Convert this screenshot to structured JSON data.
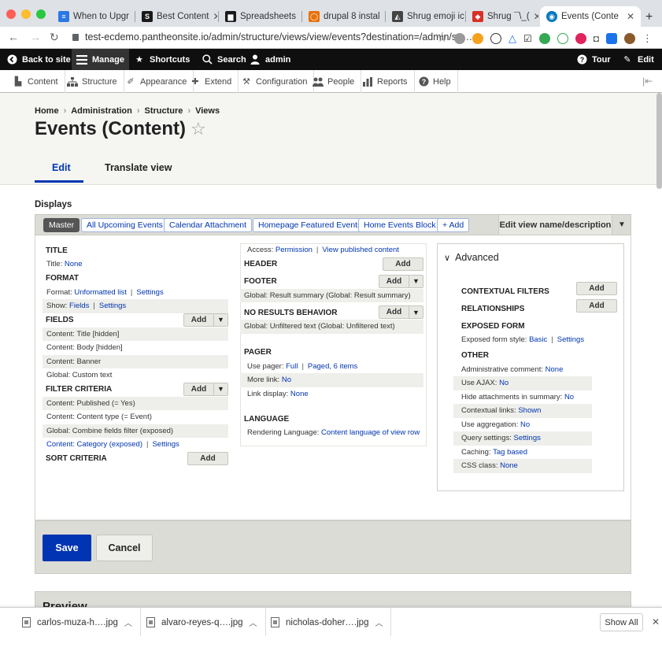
{
  "browser": {
    "tabs": [
      {
        "title": "When to Upgr",
        "icon_color": "#2b78e4",
        "icon_text": "≡"
      },
      {
        "title": "Best Content",
        "icon_color": "#1a1a1a",
        "icon_text": "S"
      },
      {
        "title": "Spreadsheets",
        "icon_color": "#1a1a1a",
        "icon_text": "▆"
      },
      {
        "title": "drupal 8 instal",
        "icon_color": "#e8710a",
        "icon_text": "◯"
      },
      {
        "title": "Shrug emoji ic",
        "icon_color": "#444444",
        "icon_text": "◭"
      },
      {
        "title": "Shrug ¯\\_(",
        "icon_color": "#d93025",
        "icon_text": "◆"
      },
      {
        "title": "Events (Conte",
        "icon_color": "#0678be",
        "icon_text": "◉"
      }
    ],
    "url": "test-ecdemo.pantheonsite.io/admin/structure/views/view/events?destination=/admin/str…",
    "traffic_colors": [
      "#ff5f57",
      "#febc2e",
      "#28c840"
    ]
  },
  "toolbar": {
    "back": "Back to site",
    "manage": "Manage",
    "shortcuts": "Shortcuts",
    "search": "Search",
    "user": "admin",
    "tour": "Tour",
    "edit": "Edit"
  },
  "tray": [
    "Content",
    "Structure",
    "Appearance",
    "Extend",
    "Configuration",
    "People",
    "Reports",
    "Help"
  ],
  "breadcrumb": [
    "Home",
    "Administration",
    "Structure",
    "Views"
  ],
  "page_title": "Events (Content)",
  "page_tabs": {
    "edit": "Edit",
    "translate": "Translate view"
  },
  "displays": {
    "label": "Displays",
    "buttons": [
      "Master",
      "All Upcoming Events",
      "Calendar Attachment",
      "Homepage Featured Events",
      "Home Events Block",
      "+ Add"
    ],
    "edit_name": "Edit view name/description"
  },
  "col1": {
    "title_h": "TITLE",
    "title_label": "Title:",
    "title_val": "None",
    "format_h": "FORMAT",
    "format_label": "Format:",
    "format_val": "Unformatted list",
    "format_settings": "Settings",
    "show_label": "Show:",
    "show_val": "Fields",
    "show_settings": "Settings",
    "fields_h": "FIELDS",
    "fields": [
      "Content: Title [hidden]",
      "Content: Body [hidden]",
      "Content: Banner",
      "Global: Custom text"
    ],
    "filter_h": "FILTER CRITERIA",
    "filters": [
      "Content: Published (= Yes)",
      "Content: Content type (= Event)",
      "Global: Combine fields filter (exposed)"
    ],
    "filter_last": "Content: Category (exposed)",
    "filter_last_settings": "Settings",
    "sort_h": "SORT CRITERIA",
    "add": "Add"
  },
  "col2": {
    "access_label": "Access:",
    "access_val": "Permission",
    "access_link": "View published content",
    "header_h": "HEADER",
    "footer_h": "FOOTER",
    "footer_item": "Global: Result summary (Global: Result summary)",
    "nores_h": "NO RESULTS BEHAVIOR",
    "nores_item": "Global: Unfiltered text (Global: Unfiltered text)",
    "pager_h": "PAGER",
    "pager_label": "Use pager:",
    "pager_val": "Full",
    "pager_items": "Paged, 6 items",
    "more_label": "More link:",
    "more_val": "No",
    "link_label": "Link display:",
    "link_val": "None",
    "lang_h": "LANGUAGE",
    "lang_label": "Rendering Language:",
    "lang_val": "Content language of view row",
    "add": "Add"
  },
  "advanced": {
    "heading": "Advanced",
    "ctx_h": "CONTEXTUAL FILTERS",
    "rel_h": "RELATIONSHIPS",
    "exposed_h": "EXPOSED FORM",
    "exposed_label": "Exposed form style:",
    "exposed_val": "Basic",
    "exposed_settings": "Settings",
    "other_h": "OTHER",
    "other": [
      {
        "label": "Administrative comment:",
        "val": "None"
      },
      {
        "label": "Use AJAX:",
        "val": "No"
      },
      {
        "label": "Hide attachments in summary:",
        "val": "No"
      },
      {
        "label": "Contextual links:",
        "val": "Shown"
      },
      {
        "label": "Use aggregation:",
        "val": "No"
      },
      {
        "label": "Query settings:",
        "val": "Settings"
      },
      {
        "label": "Caching:",
        "val": "Tag based"
      },
      {
        "label": "CSS class:",
        "val": "None"
      }
    ],
    "add": "Add"
  },
  "actions": {
    "save": "Save",
    "cancel": "Cancel"
  },
  "preview": "Preview",
  "downloads": {
    "files": [
      "carlos-muza-h….jpg",
      "alvaro-reyes-q….jpg",
      "nicholas-doher….jpg"
    ],
    "show_all": "Show All"
  }
}
